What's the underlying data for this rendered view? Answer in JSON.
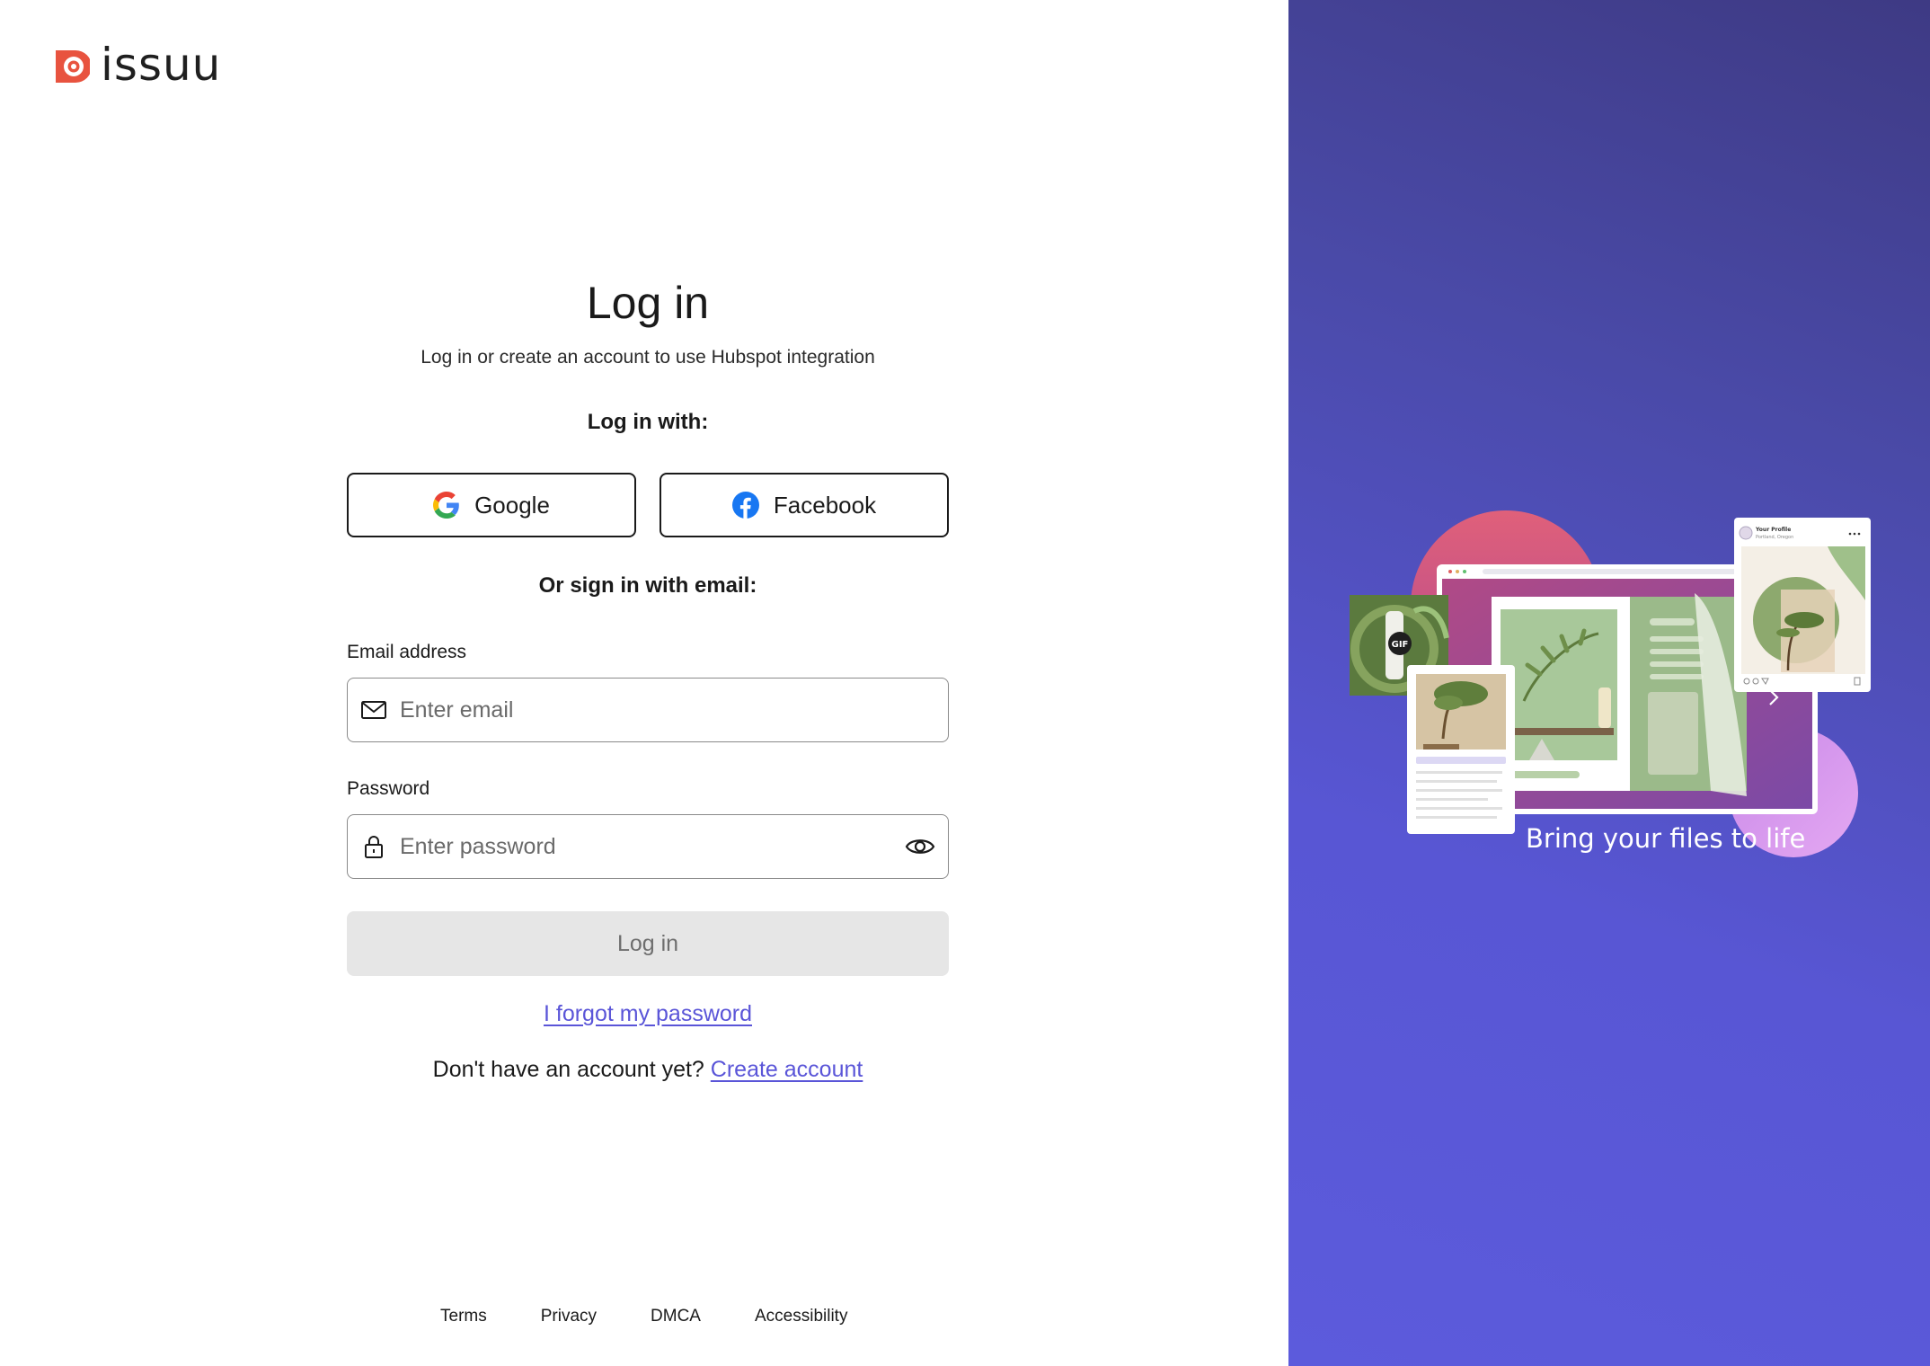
{
  "brand": {
    "name": "issuu",
    "color": "#e8533f"
  },
  "login": {
    "title": "Log in",
    "subtitle": "Log in or create an account to use Hubspot integration",
    "login_with_label": "Log in with:",
    "google_label": "Google",
    "facebook_label": "Facebook",
    "email_divider_label": "Or sign in with email:",
    "email_label": "Email address",
    "email_placeholder": "Enter email",
    "password_label": "Password",
    "password_placeholder": "Enter password",
    "submit_label": "Log in",
    "forgot_label": "I forgot my password",
    "signup_prompt": "Don't have an account yet?",
    "signup_link": "Create account"
  },
  "footer": {
    "links": [
      "Terms",
      "Privacy",
      "DMCA",
      "Accessibility"
    ]
  },
  "promo": {
    "tagline": "Bring your files to life",
    "gif_badge": "GIF",
    "card_title": "Your Profile",
    "card_subtitle": "Portland, Oregon"
  },
  "colors": {
    "link": "#5a55d8",
    "panel": "#5856d4",
    "facebook": "#1877f2"
  }
}
